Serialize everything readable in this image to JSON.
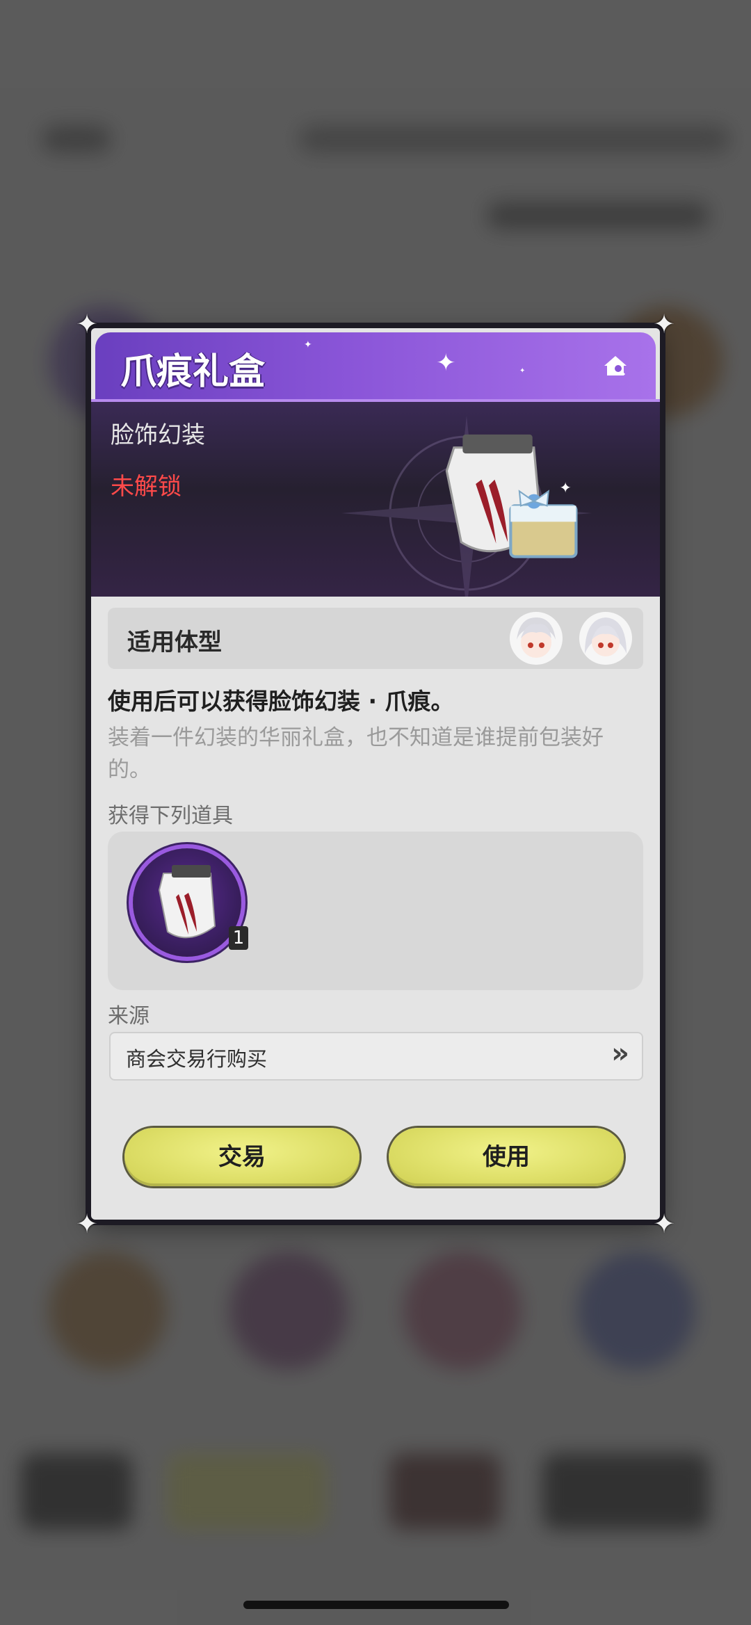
{
  "dialog": {
    "title": "爪痕礼盒",
    "category": "脸饰幻装",
    "status": "未解锁",
    "applicable_body_label": "适用体型",
    "description_main": "使用后可以获得脸饰幻装 · 爪痕。",
    "description_flavor": "装着一件幻装的华丽礼盒，也不知道是谁提前包装好的。",
    "rewards_label": "获得下列道具",
    "rewards": [
      {
        "name": "claw-mark-face-accessory",
        "count": "1"
      }
    ],
    "source_label": "来源",
    "source_entry": "商会交易行购买",
    "source_arrow": "»",
    "buttons": {
      "trade": "交易",
      "use": "使用"
    }
  },
  "colors": {
    "header_purple": "#8a55d8",
    "locked_red": "#ff4a4a",
    "button_yellow": "#e3e46c"
  },
  "icons": [
    "home-search-icon",
    "corner-star-icon",
    "claw-gift-box-icon",
    "avatar-icon"
  ]
}
